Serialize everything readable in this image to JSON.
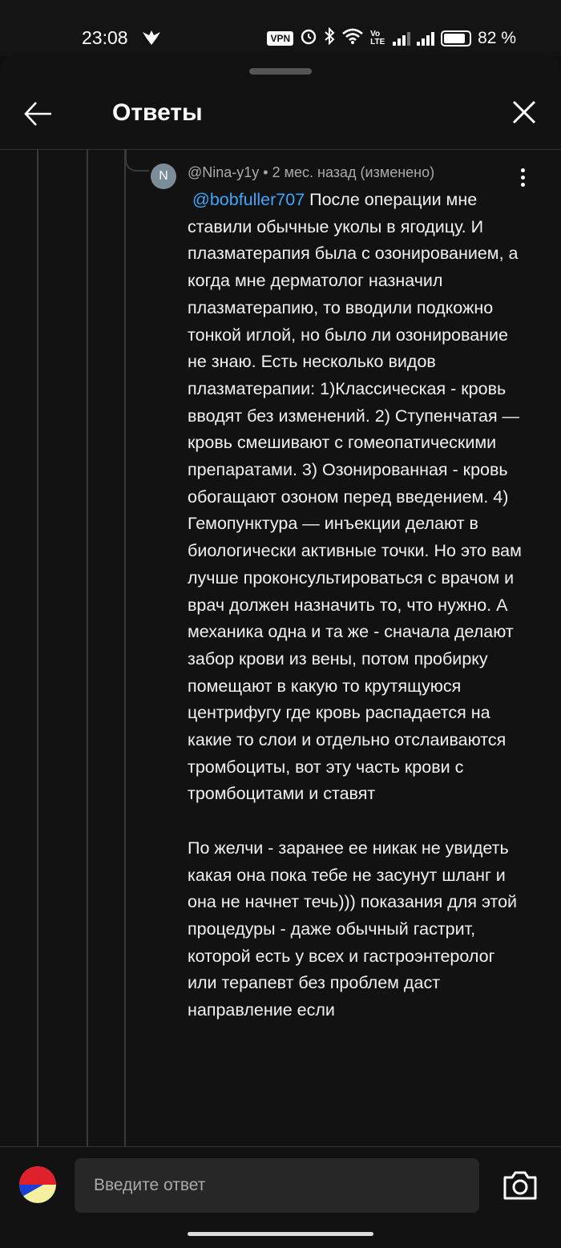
{
  "status_bar": {
    "time": "23:08",
    "vpn_label": "VPN",
    "network_label": "Vo LTE",
    "battery_percent": "82 %"
  },
  "header": {
    "title": "Ответы"
  },
  "comment": {
    "avatar_letter": "N",
    "author": "@Nina-y1y",
    "meta_suffix": " • 2 мес. назад (изменено)",
    "mention": "@bobfuller707",
    "text_part1": " После операции мне ставили обычные уколы в ягодицу. И плазматерапия была с озонированием, а когда мне дерматолог назначил плазматерапию, то вводили подкожно тонкой иглой, но было ли озонирование не знаю. Есть несколько видов плазматерапии: 1)Классическая - кровь вводят без изменений. 2) Ступенчатая — кровь смешивают с гомеопатическими препаратами. 3) Озонированная - кровь обогащают озоном перед введением. 4) Гемопунктура — инъекции делают в биологически активные точки. Но это вам лучше проконсультироваться с врачом и врач должен назначить то, что нужно. А механика одна и та же - сначала делают забор крови из вены, потом пробирку помещают в какую то крутящуюся центрифугу где кровь распадается на какие то слои и отдельно отслаиваются тромбоциты, вот эту часть крови с тромбоцитами и ставят",
    "text_part2": "По желчи -  заранее ее никак не увидеть какая она пока тебе не засунут шланг и она не начнет течь))) показания для этой процедуры - даже обычный гастрит, которой есть у всех и гастроэнтеролог или терапевт без проблем даст направление если"
  },
  "composer": {
    "placeholder": "Введите ответ"
  },
  "colors": {
    "accent_link": "#3ea6ff",
    "background": "#121212"
  },
  "icons": [
    "back-arrow-icon",
    "close-icon",
    "more-vert-icon",
    "camera-icon",
    "vpn-icon",
    "alarm-icon",
    "bluetooth-icon",
    "wifi-icon",
    "signal-icon",
    "battery-icon"
  ]
}
